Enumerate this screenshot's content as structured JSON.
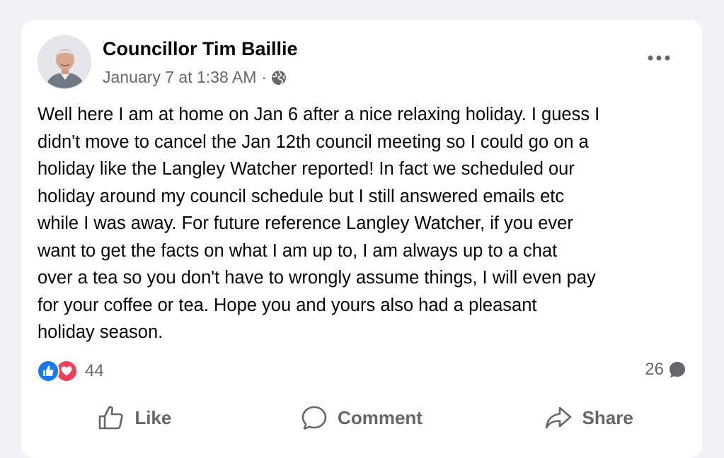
{
  "post": {
    "author": "Councillor Tim Baillie",
    "timestamp": "January 7 at 1:38 AM",
    "separator": "·",
    "privacy_icon": "globe-icon",
    "more_icon": "more-options-icon",
    "text": "Well here I am at home on Jan 6 after a nice relaxing holiday. I guess I\ndidn't move to cancel the Jan 12th council meeting so I could go on a\nholiday like the Langley Watcher reported! In fact we scheduled our\nholiday around my council schedule but I still answered emails etc\nwhile I was away. For future reference Langley Watcher, if you ever\nwant to get the facts on what I am up to, I am always up to a chat\nover a tea so you don't have to wrongly assume things, I will even pay\nfor your coffee or tea. Hope you and yours also had a pleasant\nholiday season."
  },
  "stats": {
    "reaction_icons": [
      "like-reaction-icon",
      "love-reaction-icon"
    ],
    "reaction_count": "44",
    "comment_count": "26",
    "comment_icon": "comment-bubble-icon"
  },
  "actions": {
    "like_label": "Like",
    "comment_label": "Comment",
    "share_label": "Share"
  },
  "colors": {
    "like_blue": "#1877f2",
    "love_red": "#f33e58",
    "secondary_text": "#65676b",
    "background": "#f0f2f5"
  }
}
